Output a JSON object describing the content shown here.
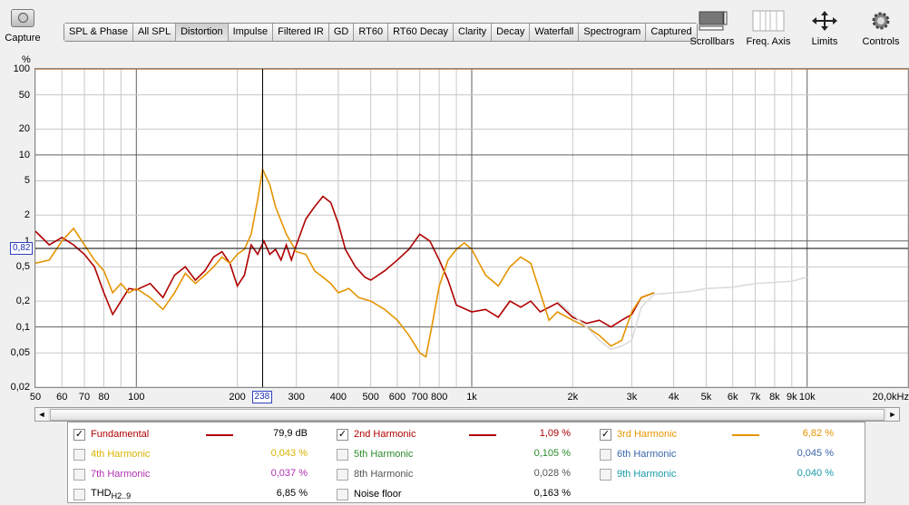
{
  "capture": {
    "label": "Capture"
  },
  "tabs": [
    "SPL & Phase",
    "All SPL",
    "Distortion",
    "Impulse",
    "Filtered IR",
    "GD",
    "RT60",
    "RT60 Decay",
    "Clarity",
    "Decay",
    "Waterfall",
    "Spectrogram",
    "Captured"
  ],
  "active_tab": "Distortion",
  "tools": [
    {
      "label": "Scrollbars",
      "icon": "scrollbars-icon"
    },
    {
      "label": "Freq. Axis",
      "icon": "freq-axis-icon"
    },
    {
      "label": "Limits",
      "icon": "limits-icon"
    },
    {
      "label": "Controls",
      "icon": "gear-icon"
    }
  ],
  "chart_data": {
    "type": "line",
    "ylabel": "%",
    "y_scale": "log",
    "x_scale": "log",
    "ylim": [
      0.02,
      100
    ],
    "xlim": [
      50,
      20000
    ],
    "y_ticks": [
      {
        "v": 100,
        "t": "100"
      },
      {
        "v": 50,
        "t": "50"
      },
      {
        "v": 20,
        "t": "20"
      },
      {
        "v": 10,
        "t": "10"
      },
      {
        "v": 5,
        "t": "5"
      },
      {
        "v": 2,
        "t": "2"
      },
      {
        "v": 1,
        "t": "1"
      },
      {
        "v": 0.5,
        "t": "0,5"
      },
      {
        "v": 0.2,
        "t": "0,2"
      },
      {
        "v": 0.1,
        "t": "0,1"
      },
      {
        "v": 0.05,
        "t": "0,05"
      },
      {
        "v": 0.02,
        "t": "0,02"
      }
    ],
    "x_ticks": [
      {
        "v": 50,
        "t": "50"
      },
      {
        "v": 60,
        "t": "60"
      },
      {
        "v": 70,
        "t": "70"
      },
      {
        "v": 80,
        "t": "80"
      },
      {
        "v": 100,
        "t": "100"
      },
      {
        "v": 200,
        "t": "200"
      },
      {
        "v": 300,
        "t": "300"
      },
      {
        "v": 400,
        "t": "400"
      },
      {
        "v": 500,
        "t": "500"
      },
      {
        "v": 600,
        "t": "600"
      },
      {
        "v": 700,
        "t": "700"
      },
      {
        "v": 800,
        "t": "800"
      },
      {
        "v": 1000,
        "t": "1k"
      },
      {
        "v": 2000,
        "t": "2k"
      },
      {
        "v": 3000,
        "t": "3k"
      },
      {
        "v": 4000,
        "t": "4k"
      },
      {
        "v": 5000,
        "t": "5k"
      },
      {
        "v": 6000,
        "t": "6k"
      },
      {
        "v": 7000,
        "t": "7k"
      },
      {
        "v": 8000,
        "t": "8k"
      },
      {
        "v": 9000,
        "t": "9k"
      },
      {
        "v": 10000,
        "t": "10k"
      },
      {
        "v": 20000,
        "t": "20,0kHz"
      }
    ],
    "cursor": {
      "x": 238,
      "x_label": "238",
      "y": 0.82,
      "y_label": "0,82"
    },
    "series": [
      {
        "name": "2nd Harmonic",
        "color": "#b00000",
        "points": [
          [
            50,
            1.3
          ],
          [
            55,
            0.9
          ],
          [
            60,
            1.1
          ],
          [
            65,
            0.9
          ],
          [
            70,
            0.7
          ],
          [
            75,
            0.5
          ],
          [
            80,
            0.25
          ],
          [
            85,
            0.14
          ],
          [
            90,
            0.2
          ],
          [
            95,
            0.28
          ],
          [
            100,
            0.27
          ],
          [
            110,
            0.32
          ],
          [
            120,
            0.22
          ],
          [
            130,
            0.4
          ],
          [
            140,
            0.5
          ],
          [
            150,
            0.35
          ],
          [
            160,
            0.45
          ],
          [
            170,
            0.65
          ],
          [
            180,
            0.75
          ],
          [
            190,
            0.55
          ],
          [
            200,
            0.3
          ],
          [
            210,
            0.4
          ],
          [
            220,
            0.9
          ],
          [
            230,
            0.7
          ],
          [
            240,
            1.0
          ],
          [
            250,
            0.7
          ],
          [
            260,
            0.8
          ],
          [
            270,
            0.6
          ],
          [
            280,
            0.9
          ],
          [
            290,
            0.6
          ],
          [
            300,
            0.9
          ],
          [
            320,
            1.8
          ],
          [
            340,
            2.5
          ],
          [
            360,
            3.3
          ],
          [
            380,
            2.8
          ],
          [
            400,
            1.6
          ],
          [
            420,
            0.8
          ],
          [
            450,
            0.5
          ],
          [
            480,
            0.38
          ],
          [
            500,
            0.35
          ],
          [
            550,
            0.45
          ],
          [
            600,
            0.6
          ],
          [
            650,
            0.8
          ],
          [
            700,
            1.2
          ],
          [
            750,
            1.0
          ],
          [
            800,
            0.6
          ],
          [
            850,
            0.35
          ],
          [
            900,
            0.18
          ],
          [
            1000,
            0.15
          ],
          [
            1100,
            0.16
          ],
          [
            1200,
            0.13
          ],
          [
            1300,
            0.2
          ],
          [
            1400,
            0.17
          ],
          [
            1500,
            0.2
          ],
          [
            1600,
            0.15
          ],
          [
            1800,
            0.19
          ],
          [
            2000,
            0.13
          ],
          [
            2200,
            0.11
          ],
          [
            2400,
            0.12
          ],
          [
            2600,
            0.1
          ],
          [
            2800,
            0.12
          ],
          [
            3000,
            0.14
          ],
          [
            3200,
            0.22
          ],
          [
            3500,
            0.25
          ]
        ]
      },
      {
        "name": "3rd Harmonic",
        "color": "#e59400",
        "points": [
          [
            50,
            0.55
          ],
          [
            55,
            0.6
          ],
          [
            60,
            1.0
          ],
          [
            65,
            1.4
          ],
          [
            70,
            0.9
          ],
          [
            75,
            0.6
          ],
          [
            80,
            0.45
          ],
          [
            85,
            0.25
          ],
          [
            90,
            0.32
          ],
          [
            95,
            0.25
          ],
          [
            100,
            0.28
          ],
          [
            110,
            0.22
          ],
          [
            120,
            0.16
          ],
          [
            130,
            0.25
          ],
          [
            140,
            0.42
          ],
          [
            150,
            0.32
          ],
          [
            160,
            0.4
          ],
          [
            170,
            0.5
          ],
          [
            180,
            0.65
          ],
          [
            190,
            0.55
          ],
          [
            200,
            0.7
          ],
          [
            210,
            0.8
          ],
          [
            220,
            1.2
          ],
          [
            230,
            3.0
          ],
          [
            238,
            6.8
          ],
          [
            250,
            4.5
          ],
          [
            260,
            2.5
          ],
          [
            280,
            1.2
          ],
          [
            300,
            0.75
          ],
          [
            320,
            0.7
          ],
          [
            340,
            0.45
          ],
          [
            360,
            0.38
          ],
          [
            380,
            0.32
          ],
          [
            400,
            0.25
          ],
          [
            430,
            0.28
          ],
          [
            460,
            0.22
          ],
          [
            500,
            0.2
          ],
          [
            550,
            0.16
          ],
          [
            600,
            0.12
          ],
          [
            650,
            0.08
          ],
          [
            700,
            0.05
          ],
          [
            730,
            0.045
          ],
          [
            760,
            0.1
          ],
          [
            800,
            0.3
          ],
          [
            850,
            0.6
          ],
          [
            900,
            0.8
          ],
          [
            950,
            0.95
          ],
          [
            1000,
            0.8
          ],
          [
            1100,
            0.4
          ],
          [
            1200,
            0.3
          ],
          [
            1300,
            0.5
          ],
          [
            1400,
            0.65
          ],
          [
            1500,
            0.55
          ],
          [
            1600,
            0.25
          ],
          [
            1700,
            0.12
          ],
          [
            1800,
            0.15
          ],
          [
            2000,
            0.12
          ],
          [
            2200,
            0.1
          ],
          [
            2400,
            0.08
          ],
          [
            2600,
            0.06
          ],
          [
            2800,
            0.07
          ],
          [
            3000,
            0.15
          ],
          [
            3200,
            0.22
          ],
          [
            3500,
            0.25
          ]
        ]
      },
      {
        "name": "Noise floor",
        "color": "#dcdcdc",
        "points": [
          [
            1800,
            0.2
          ],
          [
            2000,
            0.14
          ],
          [
            2200,
            0.1
          ],
          [
            2400,
            0.07
          ],
          [
            2600,
            0.055
          ],
          [
            2800,
            0.06
          ],
          [
            3000,
            0.07
          ],
          [
            3200,
            0.17
          ],
          [
            3500,
            0.24
          ],
          [
            4000,
            0.25
          ],
          [
            4500,
            0.26
          ],
          [
            5000,
            0.28
          ],
          [
            6000,
            0.29
          ],
          [
            7000,
            0.32
          ],
          [
            8000,
            0.33
          ],
          [
            9000,
            0.34
          ],
          [
            10000,
            0.38
          ]
        ]
      }
    ]
  },
  "legend": [
    {
      "label": "Fundamental",
      "checked": true,
      "color": "#b00000",
      "value": "79,9 dB",
      "value_color": "#000000"
    },
    {
      "label": "2nd Harmonic",
      "checked": true,
      "color": "#b00000",
      "value": "1,09 %",
      "value_color": "#b00000"
    },
    {
      "label": "3rd Harmonic",
      "checked": true,
      "color": "#e59400",
      "value": "6,82 %",
      "value_color": "#e59400"
    },
    {
      "label": "4th Harmonic",
      "checked": false,
      "color": "#d8b400",
      "value": "0,043 %",
      "value_color": "#d8b400"
    },
    {
      "label": "5th Harmonic",
      "checked": false,
      "color": "#2a8a2a",
      "value": "0,105 %",
      "value_color": "#2a8a2a"
    },
    {
      "label": "6th Harmonic",
      "checked": false,
      "color": "#3a66aa",
      "value": "0,045 %",
      "value_color": "#3a66aa"
    },
    {
      "label": "7th Harmonic",
      "checked": false,
      "color": "#b030b0",
      "value": "0,037 %",
      "value_color": "#b030b0"
    },
    {
      "label": "8th Harmonic",
      "checked": false,
      "color": "#555555",
      "value": "0,028 %",
      "value_color": "#555555"
    },
    {
      "label": "9th Harmonic",
      "checked": false,
      "color": "#1a9aa8",
      "value": "0,040 %",
      "value_color": "#1a9aa8"
    },
    {
      "label": "THD",
      "label_sub": "H2..9",
      "checked": false,
      "color": "#000000",
      "value": "6,85 %",
      "value_color": "#000000"
    },
    {
      "label": "Noise floor",
      "checked": false,
      "color": "#000000",
      "value": "0,163 %",
      "value_color": "#000000"
    }
  ],
  "scroll": {
    "left": "◄",
    "right": "►"
  }
}
